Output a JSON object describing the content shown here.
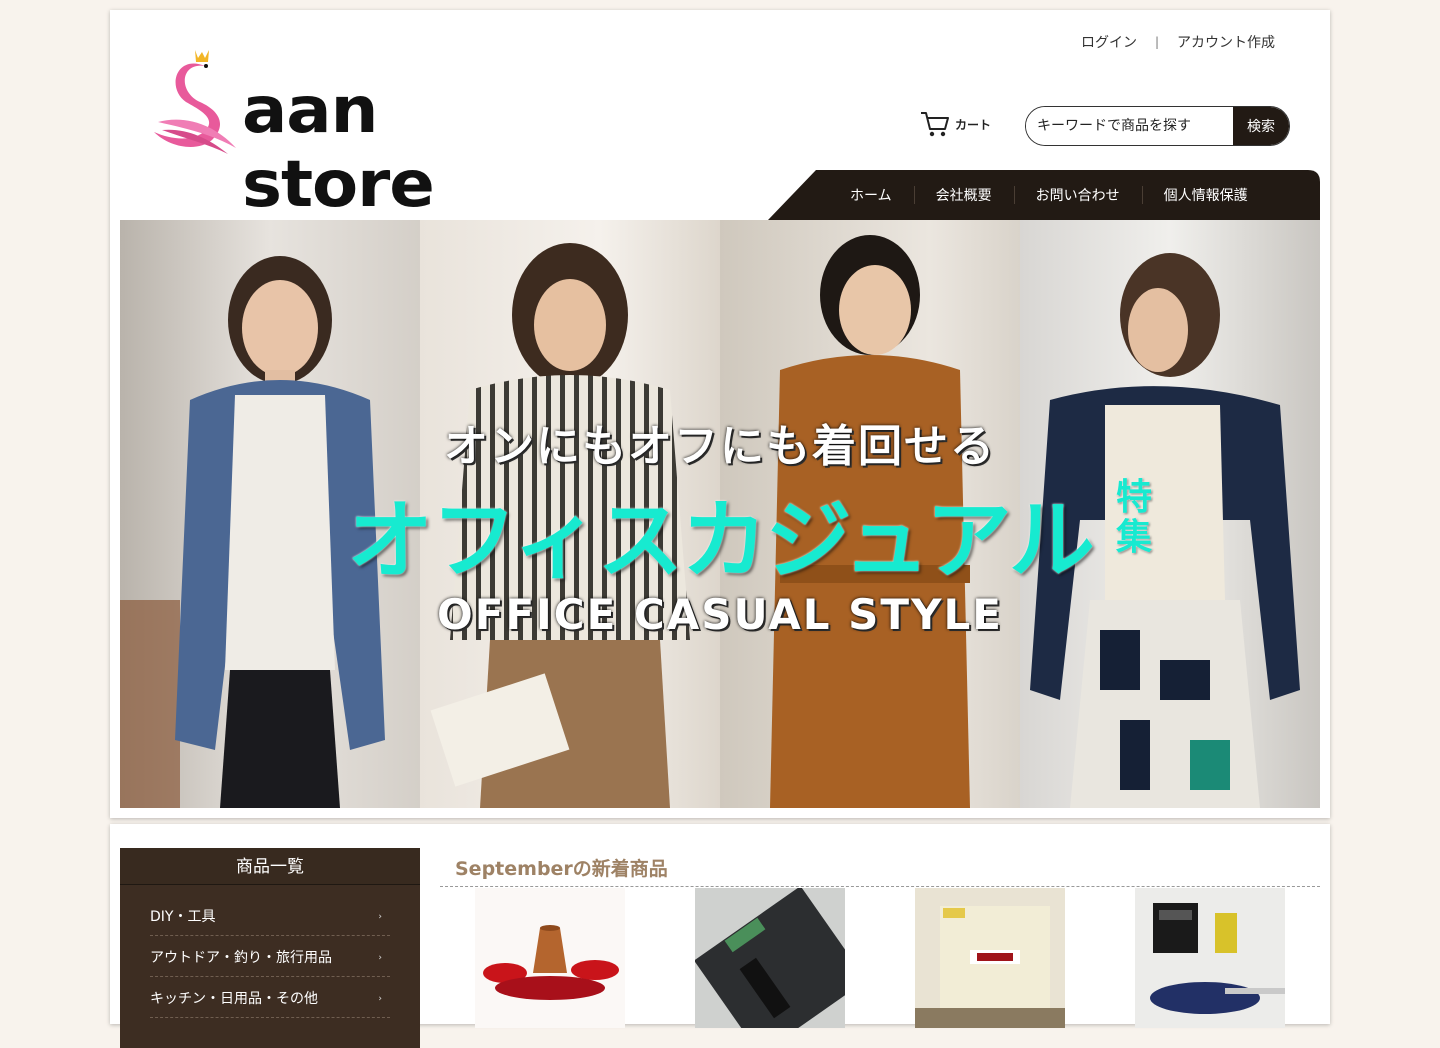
{
  "header": {
    "login_label": "ログイン",
    "separator": "|",
    "signup_label": "アカウント作成",
    "logo_text": "aan store",
    "cart_label": "カート",
    "search_placeholder": "キーワードで商品を探す",
    "search_button": "検索"
  },
  "nav": {
    "items": [
      "ホーム",
      "会社概要",
      "お問い合わせ",
      "個人情報保護"
    ]
  },
  "hero": {
    "line1": "オンにもオフにも着回せる",
    "line2": "オフィスカジュアル",
    "line2_suffix_1": "特",
    "line2_suffix_2": "集",
    "line3": "OFFICE CASUAL STYLE",
    "accent_color": "#17ead0"
  },
  "sidebar": {
    "title": "商品一覧",
    "items": [
      "DIY・工具",
      "アウトドア・釣り・旅行用品",
      "キッチン・日用品・その他"
    ]
  },
  "news": {
    "title": "Septemberの新着商品"
  },
  "colors": {
    "background": "#f8f3ed",
    "dark_brown": "#221a14",
    "title_brown": "#9e8265",
    "logo_pink": "#e85a9b",
    "crown_gold": "#f2b526"
  }
}
